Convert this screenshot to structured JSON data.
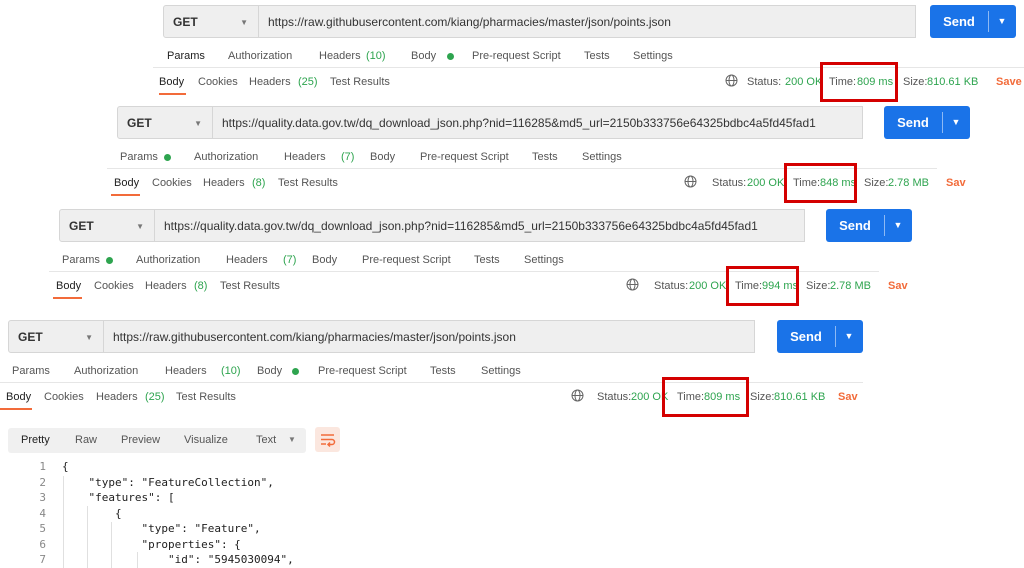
{
  "panels": [
    {
      "method": "GET",
      "url": "https://raw.githubusercontent.com/kiang/pharmacies/master/json/points.json",
      "send": "Send",
      "req_tabs": [
        "Params",
        "Authorization",
        "Headers",
        "(10)",
        "Body",
        "Pre-request Script",
        "Tests",
        "Settings"
      ],
      "res_tabs": [
        "Body",
        "Cookies",
        "Headers",
        "(25)",
        "Test Results"
      ],
      "status_label": "Status:",
      "status": "200 OK",
      "time_label": "Time:",
      "time": "809 ms",
      "size_label": "Size:",
      "size": "810.61 KB",
      "save": "Save"
    },
    {
      "method": "GET",
      "url": "https://quality.data.gov.tw/dq_download_json.php?nid=116285&md5_url=2150b333756e64325bdbc4a5fd45fad1",
      "send": "Send",
      "req_tabs": [
        "Params",
        "Authorization",
        "Headers",
        "(7)",
        "Body",
        "Pre-request Script",
        "Tests",
        "Settings"
      ],
      "res_tabs": [
        "Body",
        "Cookies",
        "Headers",
        "(8)",
        "Test Results"
      ],
      "status_label": "Status:",
      "status": "200 OK",
      "time_label": "Time:",
      "time": "848 ms",
      "size_label": "Size:",
      "size": "2.78 MB",
      "save": "Sav"
    },
    {
      "method": "GET",
      "url": "https://quality.data.gov.tw/dq_download_json.php?nid=116285&md5_url=2150b333756e64325bdbc4a5fd45fad1",
      "send": "Send",
      "req_tabs": [
        "Params",
        "Authorization",
        "Headers",
        "(7)",
        "Body",
        "Pre-request Script",
        "Tests",
        "Settings"
      ],
      "res_tabs": [
        "Body",
        "Cookies",
        "Headers",
        "(8)",
        "Test Results"
      ],
      "status_label": "Status:",
      "status": "200 OK",
      "time_label": "Time:",
      "time": "994 ms",
      "size_label": "Size:",
      "size": "2.78 MB",
      "save": "Sav"
    },
    {
      "method": "GET",
      "url": "https://raw.githubusercontent.com/kiang/pharmacies/master/json/points.json",
      "send": "Send",
      "req_tabs": [
        "Params",
        "Authorization",
        "Headers",
        "(10)",
        "Body",
        "Pre-request Script",
        "Tests",
        "Settings"
      ],
      "res_tabs": [
        "Body",
        "Cookies",
        "Headers",
        "(25)",
        "Test Results"
      ],
      "status_label": "Status:",
      "status": "200 OK",
      "time_label": "Time:",
      "time": "809 ms",
      "size_label": "Size:",
      "size": "810.61 KB",
      "save": "Sav"
    }
  ],
  "view": {
    "modes": [
      "Pretty",
      "Raw",
      "Preview",
      "Visualize"
    ],
    "format": "Text",
    "selected": "Pretty"
  },
  "code_lines": [
    {
      "n": "1",
      "text": "{"
    },
    {
      "n": "2",
      "text": "    \"type\": \"FeatureCollection\","
    },
    {
      "n": "3",
      "text": "    \"features\": ["
    },
    {
      "n": "4",
      "text": "        {"
    },
    {
      "n": "5",
      "text": "            \"type\": \"Feature\","
    },
    {
      "n": "6",
      "text": "            \"properties\": {"
    },
    {
      "n": "7",
      "text": "                \"id\": \"5945030094\","
    }
  ],
  "colors": {
    "accent": "#f26b3a",
    "send": "#1a73e8",
    "status_ok": "#2ea44f",
    "highlight_box": "#d40000"
  },
  "icons": [
    "chevron-down-icon",
    "globe-icon",
    "wrap-lines-icon"
  ]
}
